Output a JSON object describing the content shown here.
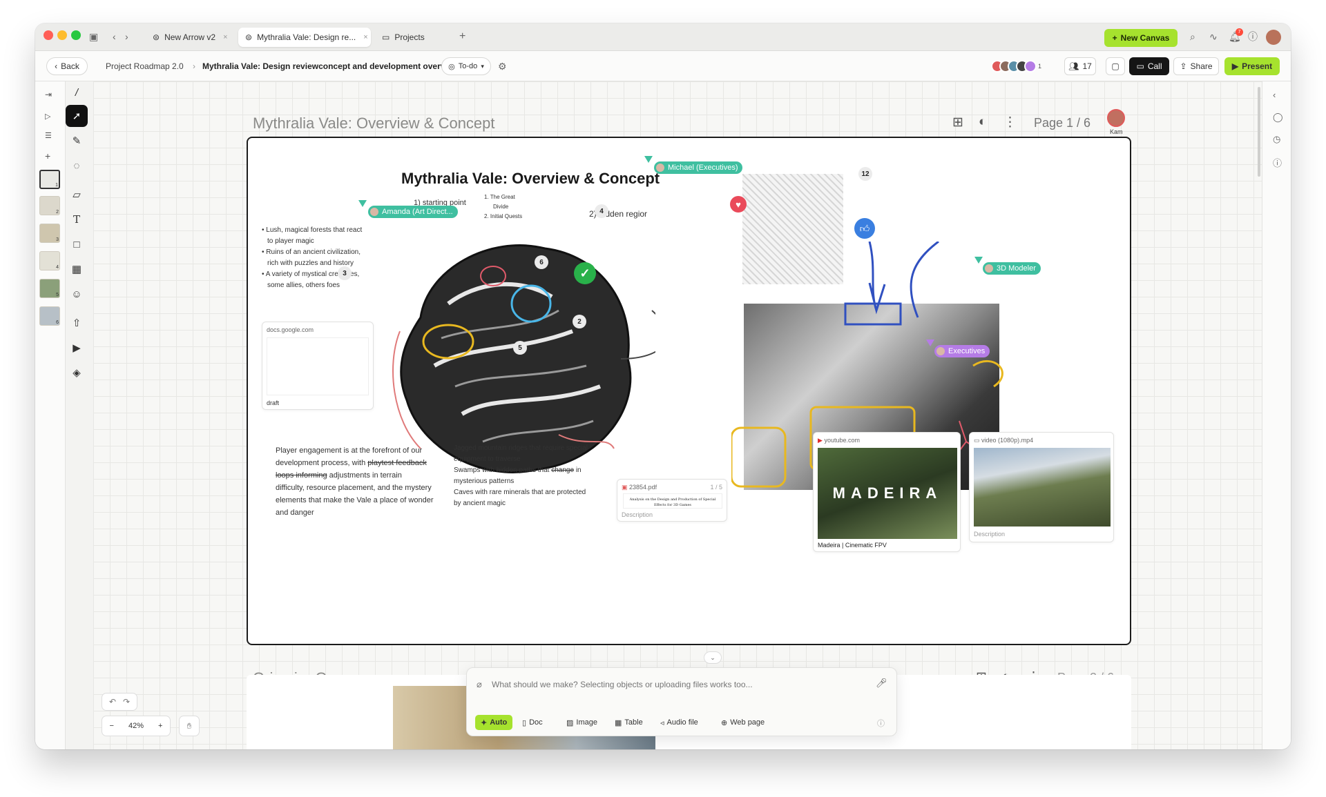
{
  "tabs": [
    {
      "label": "New Arrow v2"
    },
    {
      "label": "Mythralia Vale: Design re..."
    },
    {
      "label": "Projects"
    }
  ],
  "topbar": {
    "new_canvas": "New Canvas",
    "notif_count": "7"
  },
  "toolbar": {
    "back": "Back",
    "breadcrumb_root": "Project Roadmap 2.0",
    "breadcrumb_current": "Mythralia Vale: Design reviewconcept and development overview",
    "status": "To-do",
    "member_count": "17",
    "call": "Call",
    "share": "Share",
    "present": "Present",
    "avatar_extra": "1"
  },
  "thumbnails": [
    "1",
    "2",
    "3",
    "4",
    "5",
    "6"
  ],
  "page1": {
    "title": "Mythralia Vale: Overview & Concept",
    "pager": "Page 1 / 6",
    "presenter": "Kam",
    "heading": "Mythralia Vale: Overview & Concept",
    "starting_point": "1) starting point",
    "hidden_region": "2) hidden regior",
    "list_items": [
      "1. The Great",
      "Divide",
      "2. Initial Quests"
    ],
    "bullets": [
      "• Lush, magical forests that react",
      "to player magic",
      "• Ruins of an ancient civilization,",
      "rich with puzzles and history",
      "• A variety of mystical creatures,",
      "some allies, others foes"
    ],
    "badges": {
      "b12": "12",
      "b4": "4",
      "b6": "6",
      "b3": "3",
      "b2": "2",
      "b5": "5"
    },
    "chips": {
      "michael": "Michael (Executives)",
      "amanda": "Amanda (Art Direct...",
      "modeler": "3D Modeler",
      "executives": "Executives"
    },
    "gdoc": {
      "src": "docs.google.com",
      "label": "draft"
    },
    "engagement": [
      "Player engagement is at the forefront of our",
      "development process, with",
      "playtest feedback",
      "loops informing",
      "adjustments in terrain",
      "difficulty, resource placement, and the mystery",
      "elements that make the Vale a place of wonder",
      "and danger"
    ],
    "features": [
      "Jagged mountain ridges that require special",
      "equipment to traverse",
      "Swamps with",
      "hidden paths",
      "that",
      "change",
      "in",
      "mysterious patterns",
      "Caves with rare minerals that are protected",
      "by ancient magic"
    ],
    "pdf": {
      "src": "23854.pdf",
      "pages": "1 / 5",
      "doc_title": "Analysis on the Design and Production of Special Effects for 3D Games",
      "desc": "Description"
    },
    "youtube": {
      "src": "youtube.com",
      "overlay": "MADEIRA",
      "caption": "Madeira | Cinematic FPV"
    },
    "video": {
      "src": "video (1080p).mp4",
      "desc": "Description"
    }
  },
  "page2": {
    "title": "Grimoire Grove",
    "pager": "Page 2 / 6"
  },
  "chatbar": {
    "placeholder": "What should we make? Selecting objects or uploading files works too...",
    "buttons": [
      "Auto",
      "Doc",
      "Image",
      "Table",
      "Audio file",
      "Web page"
    ]
  },
  "zoom": {
    "level": "42%"
  },
  "colors": {
    "accent": "#a6e22e",
    "teal": "#3fbfa0",
    "purple": "#b57ce6"
  }
}
